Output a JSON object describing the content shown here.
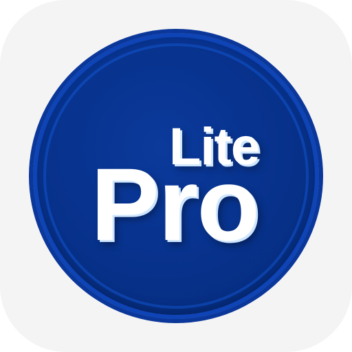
{
  "icon": {
    "word_small": "Lite",
    "word_large": "Pro",
    "colors": {
      "tile": "#f4f4f4",
      "badge": "#07318a",
      "badge_rim": "#0a3799",
      "text": "#ffffff",
      "text_glow": "#cfe6ff"
    }
  }
}
